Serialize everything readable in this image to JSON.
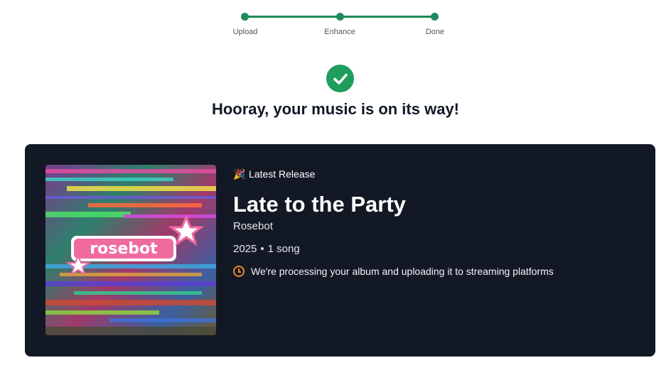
{
  "stepper": {
    "steps": [
      {
        "label": "Upload"
      },
      {
        "label": "Enhance"
      },
      {
        "label": "Done"
      }
    ],
    "color": "#1f8a5b"
  },
  "success": {
    "icon": "check-circle-icon",
    "headline": "Hooray, your music is on its way!"
  },
  "release": {
    "badge_icon": "party-popper-icon",
    "badge_emoji": "🎉",
    "badge_label": "Latest Release",
    "title": "Late to the Party",
    "artist": "Rosebot",
    "year": "2025",
    "separator": "•",
    "song_count": "1 song",
    "cover_text": "rosebot",
    "status_icon": "clock-icon",
    "status_text": "We're processing your album and uploading it to streaming platforms",
    "status_color": "#f08a24"
  }
}
